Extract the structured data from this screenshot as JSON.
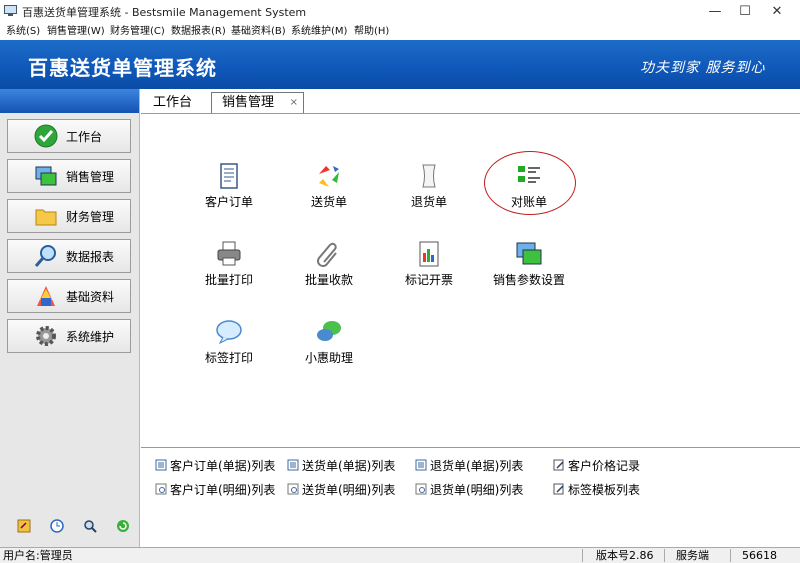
{
  "window": {
    "title": "百惠送货单管理系统 - Bestsmile Management System",
    "minimize": "—",
    "maximize": "☐",
    "close": "✕"
  },
  "menu": [
    "系统(S)",
    "销售管理(W)",
    "财务管理(C)",
    "数据报表(R)",
    "基础资料(B)",
    "系统维护(M)",
    "帮助(H)"
  ],
  "banner": {
    "title": "百惠送货单管理系统",
    "slogan": "功夫到家  服务到心"
  },
  "sidebar": {
    "items": [
      {
        "label": "工作台",
        "icon": "check-circle-icon"
      },
      {
        "label": "销售管理",
        "icon": "window-stack-icon"
      },
      {
        "label": "财务管理",
        "icon": "folder-icon"
      },
      {
        "label": "数据报表",
        "icon": "magnifier-icon"
      },
      {
        "label": "基础资料",
        "icon": "color-chart-icon"
      },
      {
        "label": "系统维护",
        "icon": "gear-icon"
      }
    ],
    "tools": [
      "key-icon",
      "clock-icon",
      "search-icon",
      "refresh-icon"
    ]
  },
  "tabs": {
    "home": "工作台",
    "sales": "销售管理",
    "close": "×"
  },
  "functions": [
    {
      "label": "客户订单",
      "icon": "order-form-icon"
    },
    {
      "label": "送货单",
      "icon": "recycle-arrows-icon"
    },
    {
      "label": "退货单",
      "icon": "scroll-icon"
    },
    {
      "label": "对账单",
      "icon": "checklist-icon"
    },
    {
      "label": "批量打印",
      "icon": "printer-icon"
    },
    {
      "label": "批量收款",
      "icon": "paperclip-icon"
    },
    {
      "label": "标记开票",
      "icon": "invoice-chart-icon"
    },
    {
      "label": "销售参数设置",
      "icon": "window-stack-icon"
    },
    {
      "label": "标签打印",
      "icon": "speech-bubble-icon"
    },
    {
      "label": "小惠助理",
      "icon": "chat-bubbles-icon"
    }
  ],
  "links": [
    {
      "label": "客户订单(单据)列表",
      "icon": "list-doc-icon"
    },
    {
      "label": "送货单(单据)列表",
      "icon": "list-doc-icon"
    },
    {
      "label": "退货单(单据)列表",
      "icon": "list-doc-icon"
    },
    {
      "label": "客户价格记录",
      "icon": "edit-doc-icon"
    },
    {
      "label": "客户订单(明细)列表",
      "icon": "detail-doc-icon"
    },
    {
      "label": "送货单(明细)列表",
      "icon": "detail-doc-icon"
    },
    {
      "label": "退货单(明细)列表",
      "icon": "detail-doc-icon"
    },
    {
      "label": "标签模板列表",
      "icon": "edit-doc-icon"
    }
  ],
  "status": {
    "user": "用户名:管理员",
    "version": "版本号2.86",
    "mode": "服务端",
    "code": "56618"
  }
}
